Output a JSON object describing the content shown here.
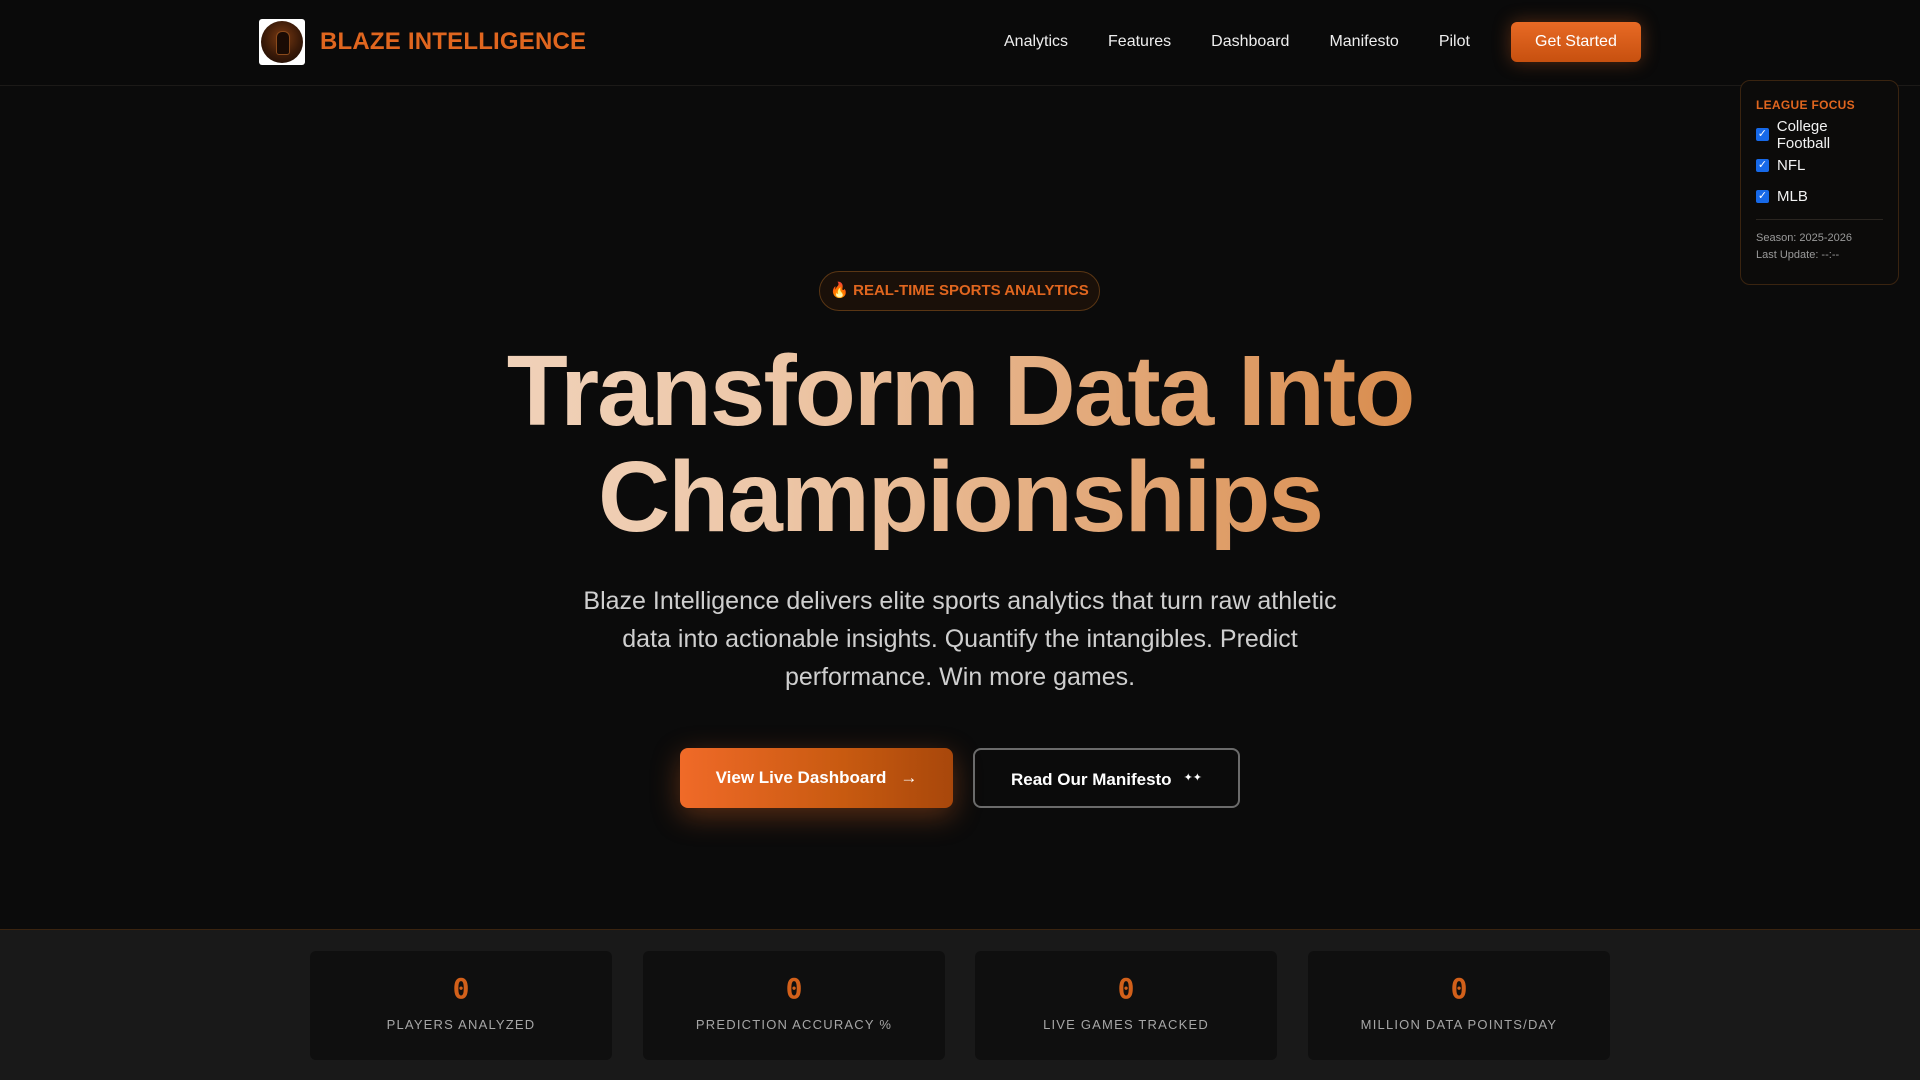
{
  "brand": {
    "name": "BLAZE INTELLIGENCE",
    "logo_icon": "flame-logo-icon"
  },
  "nav": {
    "links": [
      "Analytics",
      "Features",
      "Dashboard",
      "Manifesto",
      "Pilot"
    ],
    "cta": "Get Started"
  },
  "league": {
    "title": "LEAGUE FOCUS",
    "items": [
      {
        "label": "College Football",
        "checked": true
      },
      {
        "label": "NFL",
        "checked": true
      },
      {
        "label": "MLB",
        "checked": true
      }
    ],
    "season": "Season: 2025-2026",
    "last_update": "Last Update: --:--"
  },
  "hero": {
    "badge": "🔥 REAL-TIME SPORTS ANALYTICS",
    "headline": "Transform Data Into Championships",
    "subtitle": "Blaze Intelligence delivers elite sports analytics that turn raw athletic data into actionable insights. Quantify the intangibles. Predict performance. Win more games.",
    "primary_button": "View Live Dashboard",
    "secondary_button": "Read Our Manifesto"
  },
  "stats": [
    {
      "value": "0",
      "label": "PLAYERS ANALYZED"
    },
    {
      "value": "0",
      "label": "PREDICTION ACCURACY %"
    },
    {
      "value": "0",
      "label": "LIVE GAMES TRACKED"
    },
    {
      "value": "0",
      "label": "MILLION DATA POINTS/DAY"
    }
  ],
  "colors": {
    "accent": "#e0661f",
    "background": "#0b0b0b",
    "checkbox": "#1769e8"
  }
}
